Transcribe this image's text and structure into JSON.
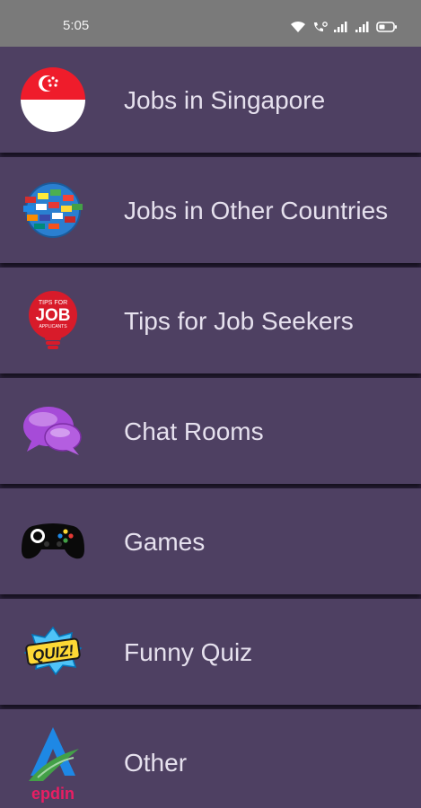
{
  "status_bar": {
    "time": "5:05",
    "icons": [
      "wifi-icon",
      "call-icon",
      "signal-icon",
      "signal-icon",
      "battery-icon"
    ]
  },
  "menu": {
    "items": [
      {
        "label": "Jobs in Singapore",
        "icon": "singapore-flag-icon"
      },
      {
        "label": "Jobs in Other Countries",
        "icon": "globe-flags-icon"
      },
      {
        "label": "Tips for Job Seekers",
        "icon": "job-tips-bulb-icon",
        "icon_text_top": "TIPS FOR",
        "icon_text_main": "JOB",
        "icon_text_bottom": "APPLICANTS"
      },
      {
        "label": "Chat Rooms",
        "icon": "chat-bubbles-icon"
      },
      {
        "label": "Games",
        "icon": "gamepad-icon"
      },
      {
        "label": "Funny Quiz",
        "icon": "quiz-badge-icon",
        "icon_text": "QUIZ!"
      },
      {
        "label": "Other",
        "icon": "epdin-logo-icon",
        "icon_text": "epdin"
      }
    ]
  },
  "colors": {
    "background": "#2e2340",
    "item": "#4e4062",
    "text": "#e6e1ee",
    "status_bar": "#7a7a7a"
  }
}
